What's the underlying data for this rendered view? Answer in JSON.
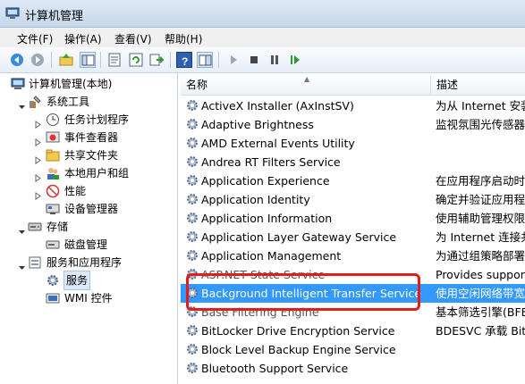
{
  "window": {
    "title": "计算机管理"
  },
  "menu": [
    "文件(F)",
    "操作(A)",
    "查看(V)",
    "帮助(H)"
  ],
  "toolbar": {
    "icons": [
      "back-icon",
      "forward-icon",
      "up-folder-icon",
      "show-tree-icon",
      "properties-icon",
      "refresh-icon",
      "export-icon",
      "help-icon",
      "console-tree-icon",
      "play-icon",
      "stop-icon",
      "pause-icon",
      "resume-icon"
    ]
  },
  "tree": {
    "root": "计算机管理(本地)",
    "system_tools": "系统工具",
    "task_scheduler": "任务计划程序",
    "event_viewer": "事件查看器",
    "shared_folders": "共享文件夹",
    "local_users": "本地用户和组",
    "performance": "性能",
    "device_manager": "设备管理器",
    "storage": "存储",
    "disk_management": "磁盘管理",
    "services_apps": "服务和应用程序",
    "services": "服务",
    "wmi": "WMI 控件"
  },
  "list": {
    "columns": [
      "名称",
      "描述"
    ],
    "rows": [
      {
        "name": "ActiveX Installer (AxInstSV)",
        "desc": "为从 Internet 安装"
      },
      {
        "name": "Adaptive Brightness",
        "desc": "监视氛围光传感器"
      },
      {
        "name": "AMD External Events Utility",
        "desc": ""
      },
      {
        "name": "Andrea RT Filters Service",
        "desc": ""
      },
      {
        "name": "Application Experience",
        "desc": "在应用程序启动时"
      },
      {
        "name": "Application Identity",
        "desc": "确定并验证应用程"
      },
      {
        "name": "Application Information",
        "desc": "使用辅助管理权限"
      },
      {
        "name": "Application Layer Gateway Service",
        "desc": "为 Internet 连接共"
      },
      {
        "name": "Application Management",
        "desc": "为通过组策略部署"
      },
      {
        "name": "ASP.NET State Service",
        "desc": "Provides support"
      },
      {
        "name": "Background Intelligent Transfer Service",
        "desc": "使用空闲网络带宽"
      },
      {
        "name": "Base Filtering Engine",
        "desc": "基本筛选引擎(BFE)"
      },
      {
        "name": "BitLocker Drive Encryption Service",
        "desc": "BDESVC 承载 BitL"
      },
      {
        "name": "Block Level Backup Engine Service",
        "desc": ""
      },
      {
        "name": "Bluetooth Support Service",
        "desc": ""
      }
    ]
  }
}
